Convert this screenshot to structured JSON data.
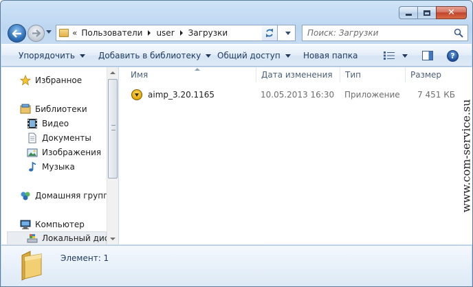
{
  "address": {
    "crumbs": [
      "Пользователи",
      "user",
      "Загрузки"
    ]
  },
  "search": {
    "placeholder": "Поиск: Загрузки"
  },
  "toolbar": {
    "organize": "Упорядочить",
    "add_to_library": "Добавить в библиотеку",
    "share": "Общий доступ",
    "new_folder": "Новая папка"
  },
  "sidebar": {
    "favorites": "Избранное",
    "libraries": "Библиотеки",
    "video": "Видео",
    "documents": "Документы",
    "images": "Изображения",
    "music": "Музыка",
    "homegroup": "Домашняя группа",
    "computer": "Компьютер",
    "local_disk": "Локальный диск"
  },
  "columns": {
    "name": "Имя",
    "date": "Дата изменения",
    "type": "Тип",
    "size": "Размер"
  },
  "files": [
    {
      "name": "aimp_3.20.1165",
      "date": "10.05.2013 16:30",
      "type": "Приложение",
      "size": "7 451 КБ"
    }
  ],
  "details": {
    "status": "Элемент: 1"
  },
  "watermark": "www.com-service.su",
  "colors": {
    "toolbar_text": "#1e395b",
    "column_header": "#4c607a",
    "accent": "#2f6fb8"
  }
}
